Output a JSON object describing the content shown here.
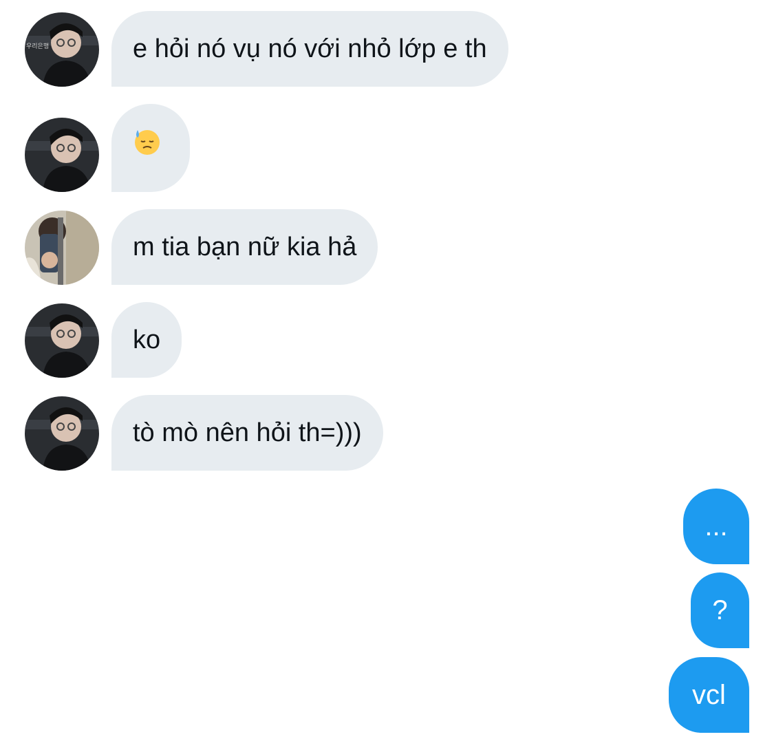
{
  "messages": {
    "incoming": [
      {
        "text": "e hỏi nó vụ nó với nhỏ lớp e th",
        "avatar": "avatar-user-dark"
      },
      {
        "text": "",
        "emoji": "downcast-face-with-sweat-emoji",
        "avatar": "avatar-user-dark"
      },
      {
        "text": "m tia bạn nữ kia hả",
        "avatar": "avatar-user-mirror"
      },
      {
        "text": "ko",
        "avatar": "avatar-user-dark"
      },
      {
        "text": "tò mò nên hỏi th=)))",
        "avatar": "avatar-user-dark"
      }
    ],
    "outgoing": [
      {
        "text": "..."
      },
      {
        "text": "?"
      },
      {
        "text": "vcl"
      }
    ]
  },
  "colors": {
    "incoming_bubble": "#e7ecf0",
    "outgoing_bubble": "#1d9bf0",
    "text_dark": "#0f1419"
  }
}
